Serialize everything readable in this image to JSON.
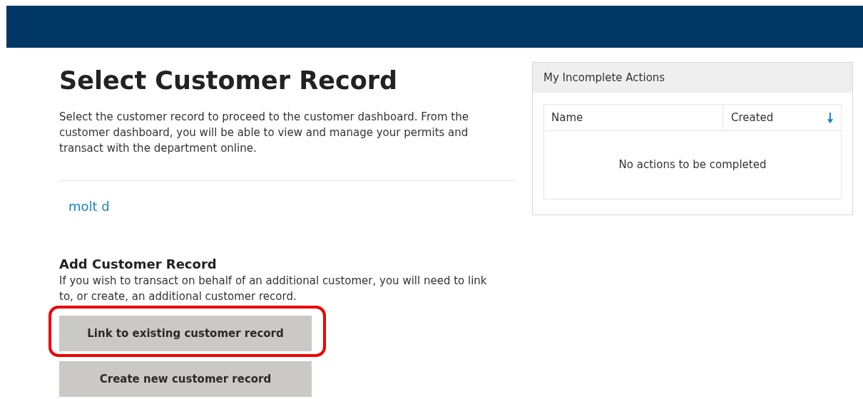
{
  "page": {
    "title": "Select Customer Record",
    "intro": "Select the customer record to proceed to the customer dashboard. From the customer dashboard, you will be able to view and manage your permits and transact with the department online."
  },
  "customer_records": [
    {
      "name": "molt d"
    }
  ],
  "add_section": {
    "title": "Add Customer Record",
    "text": "If you wish to transact on behalf of an additional customer, you will need to link to, or create, an additional customer record.",
    "buttons": [
      {
        "label": "Link to existing customer record",
        "highlighted": true
      },
      {
        "label": "Create new customer record",
        "highlighted": false
      }
    ]
  },
  "incomplete_actions": {
    "title": "My Incomplete Actions",
    "columns": [
      {
        "label": "Name",
        "sorted": false
      },
      {
        "label": "Created",
        "sorted": true
      }
    ],
    "empty_message": "No actions to be completed"
  }
}
